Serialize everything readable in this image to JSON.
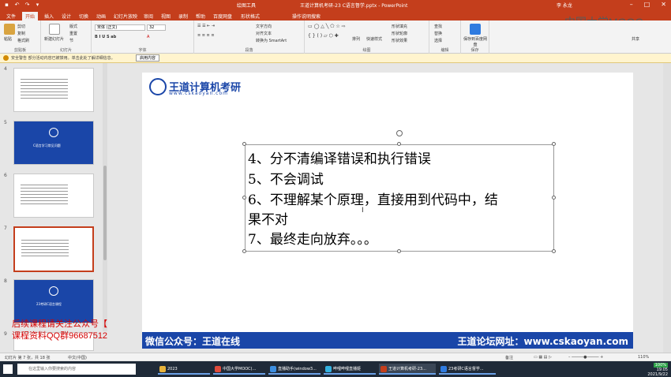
{
  "window": {
    "title": "王道计算机考研-23 C语言督学.pptx - PowerPoint",
    "tool_tab": "绘图工具",
    "user": "李 永龙"
  },
  "watermark_brand": "中国大学MOOC",
  "tabs": [
    "文件",
    "开始",
    "插入",
    "设计",
    "切换",
    "动画",
    "幻灯片放映",
    "审阅",
    "视图",
    "录制",
    "帮助",
    "百度网盘",
    "形状格式",
    "操作说明搜索"
  ],
  "ribbon": {
    "clipboard": {
      "paste": "粘贴",
      "cut": "剪切",
      "copy": "复制",
      "format_painter": "格式刷",
      "label": "剪贴板"
    },
    "slides": {
      "new_slide": "新建幻灯片",
      "layout": "版式",
      "reset": "重置",
      "section": "节",
      "label": "幻灯片"
    },
    "font": {
      "family": "宋体 (正文)",
      "size": "32",
      "label": "字体"
    },
    "paragraph": {
      "text_direction": "文字方向",
      "align_text": "对齐文本",
      "smartart": "转换为 SmartArt",
      "label": "段落"
    },
    "drawing": {
      "arrange": "排列",
      "quick_styles": "快速样式",
      "fill": "形状填充",
      "outline": "形状轮廓",
      "effects": "形状效果",
      "label": "绘图"
    },
    "editing": {
      "find": "查找",
      "replace": "替换",
      "select": "选择",
      "label": "编辑"
    },
    "save": {
      "save_baidu": "保存到百度网盘",
      "label": "保存"
    },
    "share": "共享"
  },
  "security_bar": {
    "text": "安全警告  部分活动内容已被禁用。单击此处了解详细信息。",
    "button": "启用内容"
  },
  "thumbnails": [
    {
      "num": "4"
    },
    {
      "num": "5",
      "label": "C语言学习常见问题"
    },
    {
      "num": "6"
    },
    {
      "num": "7"
    },
    {
      "num": "8",
      "label": "23考研C语言课程"
    },
    {
      "num": "9"
    }
  ],
  "overlay": {
    "line1": "后续课程请关注公众号【考研发条】",
    "line2": "课程资料QQ群966875127"
  },
  "slide": {
    "logo_title": "王道计算机考研",
    "logo_url": "www.cskaoyan.com",
    "lines": [
      "4、分不清编译错误和执行错误",
      "5、不会调试",
      "6、不理解某个原理，直接用到代码中，结",
      "果不对",
      "7、最终走向放弃。。。"
    ],
    "footer_left": "微信公众号：王道在线",
    "footer_right": "王道论坛网址：www.cskaoyan.com"
  },
  "statusbar": {
    "slide_info": "幻灯片 第 7 张，共 18 张",
    "lang": "中文(中国)",
    "notes": "备注",
    "zoom": "110%"
  },
  "taskbar": {
    "search_placeholder": "在这里输入你要搜索的内容",
    "items": [
      "2023",
      "中国大学MOOC(...",
      "直播助手(window3...",
      "哔哩哔哩直播姬",
      "王道计算机考研-23...",
      "23考研C语言督学..."
    ],
    "battery": "100%",
    "time": "19:05",
    "date": "2021/9/22"
  }
}
